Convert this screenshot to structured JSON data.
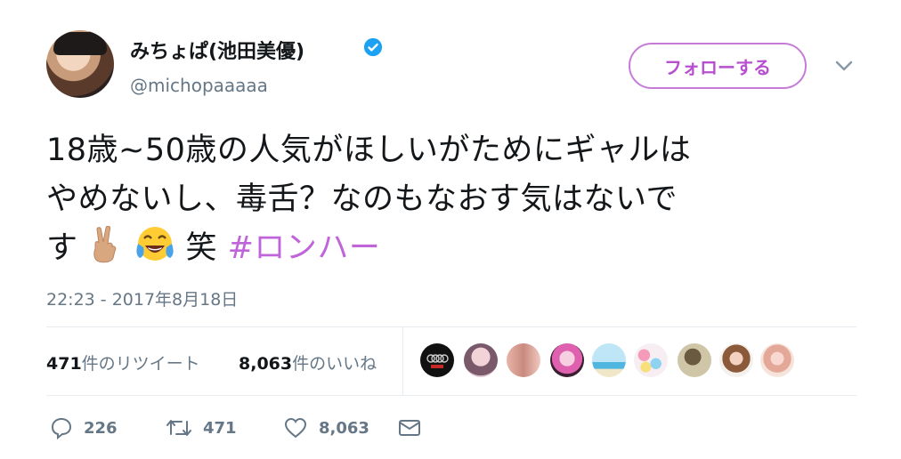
{
  "author": {
    "display_name": "みちょぱ(池田美優)",
    "handle": "@michopaaaaa",
    "verified": true
  },
  "follow_button": {
    "label": "フォローする"
  },
  "tweet": {
    "line1": "18歳~50歳の人気がほしいがためにギャルは",
    "line2": "やめないし、毒舌？なのもなおす気はないで",
    "line3_text": "す",
    "line3_after": "笑",
    "hashtag": "#ロンハー",
    "timestamp": "22:23 - 2017年8月18日"
  },
  "stats": {
    "retweets_count": "471",
    "retweets_label": "件のリツイート",
    "likes_count": "8,063",
    "likes_label": "件のいいね"
  },
  "actions": {
    "reply_count": "226",
    "retweet_count": "471",
    "like_count": "8,063"
  },
  "colors": {
    "accent": "#c065d9",
    "secondary_text": "#657786",
    "verified_blue": "#1da1f2"
  },
  "icons": [
    "verified-icon",
    "chevron-down-icon",
    "victory-hand-icon",
    "tears-of-joy-icon",
    "reply-icon",
    "retweet-icon",
    "heart-icon",
    "mail-icon"
  ]
}
